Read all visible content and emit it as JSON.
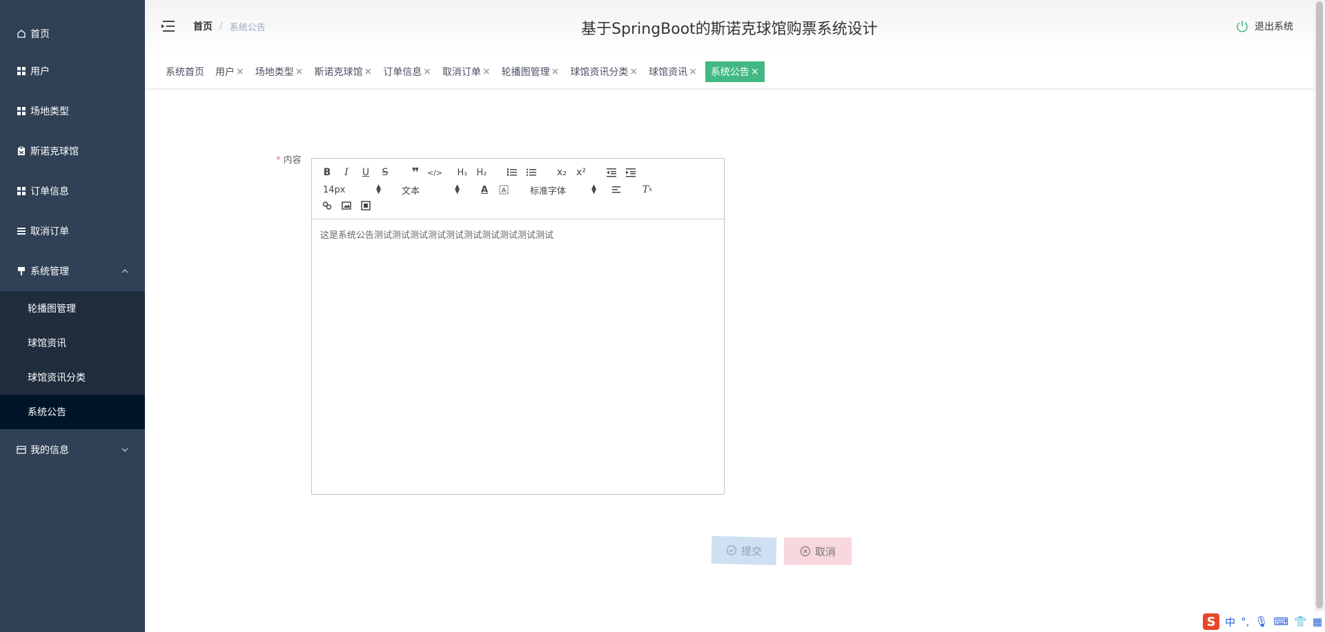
{
  "sidebar": {
    "items": [
      {
        "label": "首页",
        "icon": "home-icon"
      },
      {
        "label": "用户",
        "icon": "grid-icon"
      },
      {
        "label": "场地类型",
        "icon": "grid-icon"
      },
      {
        "label": "斯诺克球馆",
        "icon": "clipboard-icon"
      },
      {
        "label": "订单信息",
        "icon": "grid-icon"
      },
      {
        "label": "取消订单",
        "icon": "list-icon"
      }
    ],
    "system_menu": {
      "label": "系统管理",
      "icon": "stamp-icon",
      "children": [
        {
          "label": "轮播图管理"
        },
        {
          "label": "球馆资讯"
        },
        {
          "label": "球馆资讯分类"
        },
        {
          "label": "系统公告"
        }
      ]
    },
    "my_info": {
      "label": "我的信息",
      "icon": "card-icon"
    }
  },
  "header": {
    "breadcrumb_home": "首页",
    "breadcrumb_sep": "/",
    "breadcrumb_current": "系统公告",
    "title": "基于SpringBoot的斯诺克球馆购票系统设计",
    "logout": "退出系统"
  },
  "tabs": [
    {
      "label": "系统首页",
      "closable": false
    },
    {
      "label": "用户",
      "closable": true
    },
    {
      "label": "场地类型",
      "closable": true
    },
    {
      "label": "斯诺克球馆",
      "closable": true
    },
    {
      "label": "订单信息",
      "closable": true
    },
    {
      "label": "取消订单",
      "closable": true
    },
    {
      "label": "轮播图管理",
      "closable": true
    },
    {
      "label": "球馆资讯分类",
      "closable": true
    },
    {
      "label": "球馆资讯",
      "closable": true
    },
    {
      "label": "系统公告",
      "closable": true,
      "active": true
    }
  ],
  "tab_close": "×",
  "form": {
    "required_mark": "*",
    "content_label": "内容",
    "editor": {
      "font_size": "14px",
      "header_style": "文本",
      "font_family": "标准字体",
      "content": "这是系统公告测试测试测试测试测试测试测试测试测试测试"
    },
    "submit": "提交",
    "cancel": "取消"
  },
  "ime": {
    "lang": "中",
    "punct": "°,"
  },
  "colors": {
    "sidebar": "#304156",
    "active_tab": "#42b983",
    "submenu": "#1f2d3d",
    "active_submenu": "#001528"
  }
}
